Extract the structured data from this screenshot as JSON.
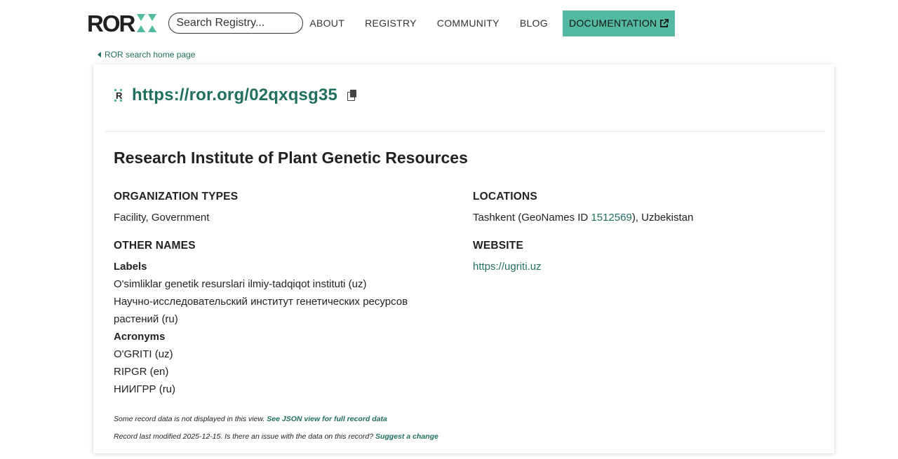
{
  "header": {
    "logo_text": "ROR",
    "search_placeholder": "Search Registry...",
    "nav": {
      "about": "ABOUT",
      "registry": "REGISTRY",
      "community": "COMMUNITY",
      "blog": "BLOG",
      "documentation": "DOCUMENTATION"
    }
  },
  "back_link": "ROR search home page",
  "record": {
    "ror_id": "https://ror.org/02qxqsg35",
    "name": "Research Institute of Plant Genetic Resources",
    "org_types_heading": "ORGANIZATION TYPES",
    "org_types": "Facility, Government",
    "other_names_heading": "OTHER NAMES",
    "labels_heading": "Labels",
    "labels": [
      "O'simliklar genetik resurslari ilmiy-tadqiqot instituti (uz)",
      "Научно-исследовательский институт генетических ресурсов растений (ru)"
    ],
    "acronyms_heading": "Acronyms",
    "acronyms": [
      "O'GRITI (uz)",
      "RIPGR (en)",
      "НИИГРР (ru)"
    ],
    "locations_heading": "LOCATIONS",
    "location_prefix": "Tashkent (GeoNames ID ",
    "geonames_id": "1512569",
    "location_suffix": "), Uzbekistan",
    "website_heading": "WEBSITE",
    "website": "https://ugriti.uz"
  },
  "footer": {
    "note1_text": "Some record data is not displayed in this view. ",
    "note1_link": "See JSON view for full record data",
    "note2_text": "Record last modified 2025-12-15. Is there an issue with the data on this record? ",
    "note2_link": "Suggest a change"
  },
  "colors": {
    "brand": "#53baa1",
    "link": "#206f60"
  }
}
